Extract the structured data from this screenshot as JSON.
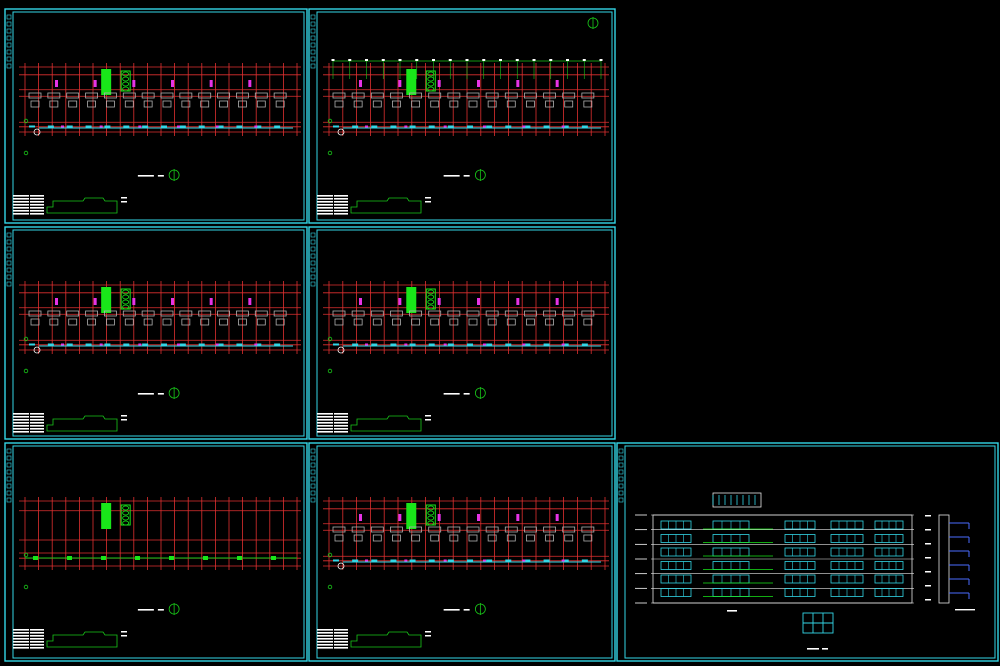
{
  "app": {
    "background": "#000000"
  },
  "colors": {
    "frame": "#33d6e6",
    "grid": "#e03030",
    "wall": "#b0b0b0",
    "stair": "#19e619",
    "accent": "#e633e6",
    "window": "#33d6e6",
    "green_line": "#19c819",
    "white": "#ffffff",
    "elev_line": "#e6e6e6"
  },
  "sheets": [
    {
      "kind": "floorplan",
      "variant": "ground"
    },
    {
      "kind": "floorplan",
      "variant": "upper-roof"
    },
    {
      "kind": "floorplan",
      "variant": "upper"
    },
    {
      "kind": "floorplan",
      "variant": "upper-b"
    },
    {
      "kind": "floorplan",
      "variant": "grid-only"
    },
    {
      "kind": "floorplan",
      "variant": "upper"
    },
    {
      "kind": "elevation",
      "variant": "elevation"
    }
  ],
  "icons": [
    "north-arrow-icon",
    "level-marker-icon"
  ]
}
